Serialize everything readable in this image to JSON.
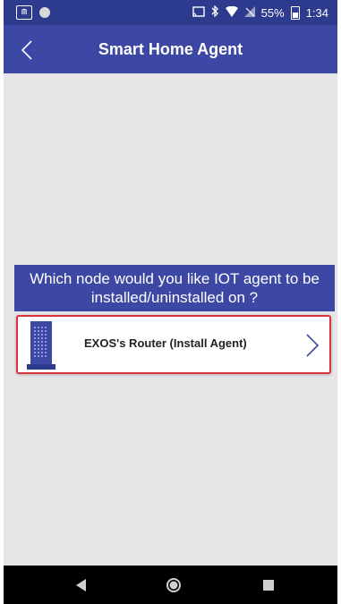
{
  "status_bar": {
    "battery_text": "55%",
    "time": "1:34",
    "icons": [
      "app-icon",
      "circle-icon",
      "cast-icon",
      "bluetooth-icon",
      "wifi-icon",
      "signal-icon",
      "battery-icon"
    ]
  },
  "app_bar": {
    "title": "Smart Home Agent",
    "back_icon": "chevron-left-icon"
  },
  "prompt": {
    "line1": "Which node would you like IOT agent to be",
    "line2": "installed/uninstalled on ?"
  },
  "nodes": [
    {
      "label": "EXOS's Router (Install Agent)",
      "icon": "router-icon"
    }
  ],
  "colors": {
    "primary": "#3c48a3",
    "status_bar": "#2c3b8e",
    "background": "#e6e6e6",
    "highlight": "#d9343c"
  }
}
